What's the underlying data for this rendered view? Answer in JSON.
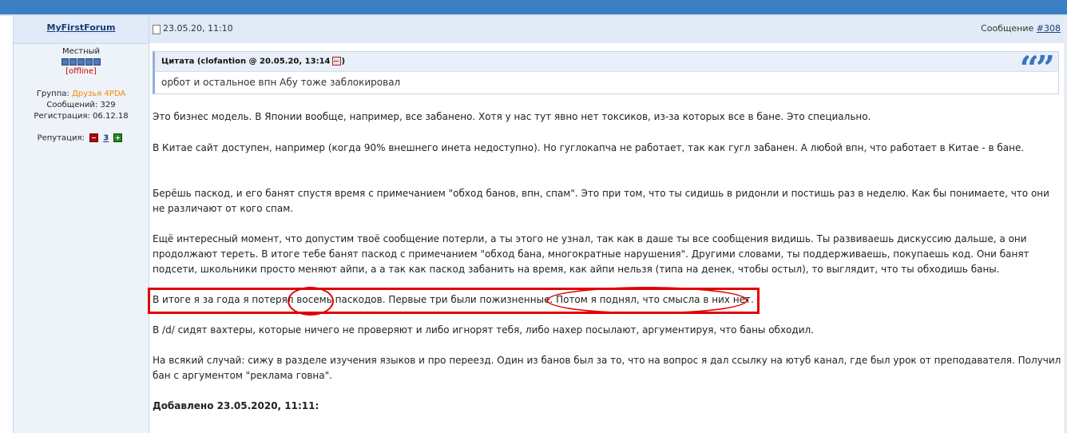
{
  "author": {
    "username": "MyFirstForum",
    "rank": "Местный",
    "status": "[offline]",
    "group_label": "Группа:",
    "group_value": "Друзья 4PDA",
    "posts_label": "Сообщений:",
    "posts_value": "329",
    "registration_label": "Регистрация:",
    "registration_value": "06.12.18",
    "reputation_label": "Репутация:",
    "reputation_value": "3",
    "rank_pips": 5
  },
  "post": {
    "date": "23.05.20, 11:10",
    "message_label": "Сообщение",
    "message_number": "#308"
  },
  "quote": {
    "title": "Цитата (clofantion @ 20.05.20, 13:14",
    "title_end": ")",
    "text": "орбот и остальное впн Абу тоже заблокировал"
  },
  "paragraphs": {
    "p1": "Это бизнес модель. В Японии вообще, например, все забанено. Хотя у нас тут явно нет токсиков, из-за которых все в бане. Это специально.",
    "p2": "В Китае сайт доступен, например (когда 90% внешнего инета недоступно). Но гуглокапча не работает, так как гугл забанен. А любой впн, что работает в Китае - в бане.",
    "p3": "Берёшь паскод, и его банят спустя время с примечанием \"обход банов, впн, спам\". Это при том, что ты сидишь в ридонли и постишь раз в неделю. Как бы понимаете, что они не различают от кого спам.",
    "p4": "Ещё интересный момент, что допустим твоё сообщение потерли, а ты этого не узнал, так как в даше ты все сообщения видишь. Ты развиваешь дискуссию дальше, а они продолжают тереть. В итоге тебе банят паскод с примечанием \"обход бана, многократные нарушения\". Другими словами, ты поддерживаешь, покупаешь код. Они банят подсети, школьники просто меняют айпи, а а так как паскод забанить на время, как айпи нельзя (типа на денек, чтобы остыл), то выглядит, что ты обходишь баны.",
    "p5": "В итоге я за года я потерял восемь паскодов. Первые три были пожизненные. Потом я поднял, что смысла в них нет.",
    "p6": "В /d/ сидят вахтеры, которые ничего не проверяют и либо игнорят тебя, либо нахер посылают, аргументируя, что баны обходил.",
    "p7": "На всякий случай: сижу в разделе изучения языков и про переезд. Один из банов был за то, что на вопрос я дал ссылку на ютуб канал, где был урок от преподавателя. Получил бан с аргументом \"реклама говна\".",
    "added": "Добавлено 23.05.2020, 11:11:"
  },
  "colors": {
    "header_bar": "#3a7fc4",
    "panel": "#e1ebf7",
    "annotation_red": "#e00000",
    "group_orange": "#f28b00"
  }
}
